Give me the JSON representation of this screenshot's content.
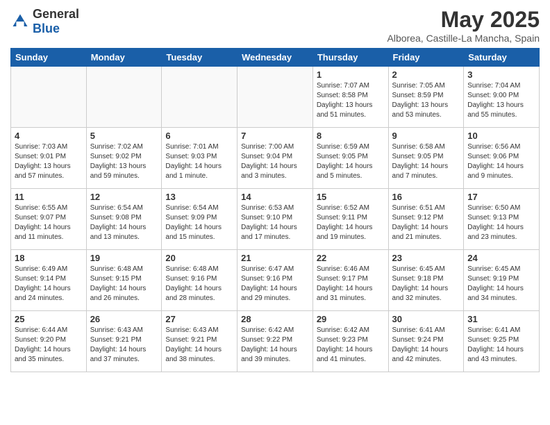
{
  "header": {
    "logo_general": "General",
    "logo_blue": "Blue",
    "title": "May 2025",
    "subtitle": "Alborea, Castille-La Mancha, Spain"
  },
  "weekdays": [
    "Sunday",
    "Monday",
    "Tuesday",
    "Wednesday",
    "Thursday",
    "Friday",
    "Saturday"
  ],
  "weeks": [
    [
      {
        "day": "",
        "content": ""
      },
      {
        "day": "",
        "content": ""
      },
      {
        "day": "",
        "content": ""
      },
      {
        "day": "",
        "content": ""
      },
      {
        "day": "1",
        "content": "Sunrise: 7:07 AM\nSunset: 8:58 PM\nDaylight: 13 hours\nand 51 minutes."
      },
      {
        "day": "2",
        "content": "Sunrise: 7:05 AM\nSunset: 8:59 PM\nDaylight: 13 hours\nand 53 minutes."
      },
      {
        "day": "3",
        "content": "Sunrise: 7:04 AM\nSunset: 9:00 PM\nDaylight: 13 hours\nand 55 minutes."
      }
    ],
    [
      {
        "day": "4",
        "content": "Sunrise: 7:03 AM\nSunset: 9:01 PM\nDaylight: 13 hours\nand 57 minutes."
      },
      {
        "day": "5",
        "content": "Sunrise: 7:02 AM\nSunset: 9:02 PM\nDaylight: 13 hours\nand 59 minutes."
      },
      {
        "day": "6",
        "content": "Sunrise: 7:01 AM\nSunset: 9:03 PM\nDaylight: 14 hours\nand 1 minute."
      },
      {
        "day": "7",
        "content": "Sunrise: 7:00 AM\nSunset: 9:04 PM\nDaylight: 14 hours\nand 3 minutes."
      },
      {
        "day": "8",
        "content": "Sunrise: 6:59 AM\nSunset: 9:05 PM\nDaylight: 14 hours\nand 5 minutes."
      },
      {
        "day": "9",
        "content": "Sunrise: 6:58 AM\nSunset: 9:05 PM\nDaylight: 14 hours\nand 7 minutes."
      },
      {
        "day": "10",
        "content": "Sunrise: 6:56 AM\nSunset: 9:06 PM\nDaylight: 14 hours\nand 9 minutes."
      }
    ],
    [
      {
        "day": "11",
        "content": "Sunrise: 6:55 AM\nSunset: 9:07 PM\nDaylight: 14 hours\nand 11 minutes."
      },
      {
        "day": "12",
        "content": "Sunrise: 6:54 AM\nSunset: 9:08 PM\nDaylight: 14 hours\nand 13 minutes."
      },
      {
        "day": "13",
        "content": "Sunrise: 6:54 AM\nSunset: 9:09 PM\nDaylight: 14 hours\nand 15 minutes."
      },
      {
        "day": "14",
        "content": "Sunrise: 6:53 AM\nSunset: 9:10 PM\nDaylight: 14 hours\nand 17 minutes."
      },
      {
        "day": "15",
        "content": "Sunrise: 6:52 AM\nSunset: 9:11 PM\nDaylight: 14 hours\nand 19 minutes."
      },
      {
        "day": "16",
        "content": "Sunrise: 6:51 AM\nSunset: 9:12 PM\nDaylight: 14 hours\nand 21 minutes."
      },
      {
        "day": "17",
        "content": "Sunrise: 6:50 AM\nSunset: 9:13 PM\nDaylight: 14 hours\nand 23 minutes."
      }
    ],
    [
      {
        "day": "18",
        "content": "Sunrise: 6:49 AM\nSunset: 9:14 PM\nDaylight: 14 hours\nand 24 minutes."
      },
      {
        "day": "19",
        "content": "Sunrise: 6:48 AM\nSunset: 9:15 PM\nDaylight: 14 hours\nand 26 minutes."
      },
      {
        "day": "20",
        "content": "Sunrise: 6:48 AM\nSunset: 9:16 PM\nDaylight: 14 hours\nand 28 minutes."
      },
      {
        "day": "21",
        "content": "Sunrise: 6:47 AM\nSunset: 9:16 PM\nDaylight: 14 hours\nand 29 minutes."
      },
      {
        "day": "22",
        "content": "Sunrise: 6:46 AM\nSunset: 9:17 PM\nDaylight: 14 hours\nand 31 minutes."
      },
      {
        "day": "23",
        "content": "Sunrise: 6:45 AM\nSunset: 9:18 PM\nDaylight: 14 hours\nand 32 minutes."
      },
      {
        "day": "24",
        "content": "Sunrise: 6:45 AM\nSunset: 9:19 PM\nDaylight: 14 hours\nand 34 minutes."
      }
    ],
    [
      {
        "day": "25",
        "content": "Sunrise: 6:44 AM\nSunset: 9:20 PM\nDaylight: 14 hours\nand 35 minutes."
      },
      {
        "day": "26",
        "content": "Sunrise: 6:43 AM\nSunset: 9:21 PM\nDaylight: 14 hours\nand 37 minutes."
      },
      {
        "day": "27",
        "content": "Sunrise: 6:43 AM\nSunset: 9:21 PM\nDaylight: 14 hours\nand 38 minutes."
      },
      {
        "day": "28",
        "content": "Sunrise: 6:42 AM\nSunset: 9:22 PM\nDaylight: 14 hours\nand 39 minutes."
      },
      {
        "day": "29",
        "content": "Sunrise: 6:42 AM\nSunset: 9:23 PM\nDaylight: 14 hours\nand 41 minutes."
      },
      {
        "day": "30",
        "content": "Sunrise: 6:41 AM\nSunset: 9:24 PM\nDaylight: 14 hours\nand 42 minutes."
      },
      {
        "day": "31",
        "content": "Sunrise: 6:41 AM\nSunset: 9:25 PM\nDaylight: 14 hours\nand 43 minutes."
      }
    ]
  ]
}
